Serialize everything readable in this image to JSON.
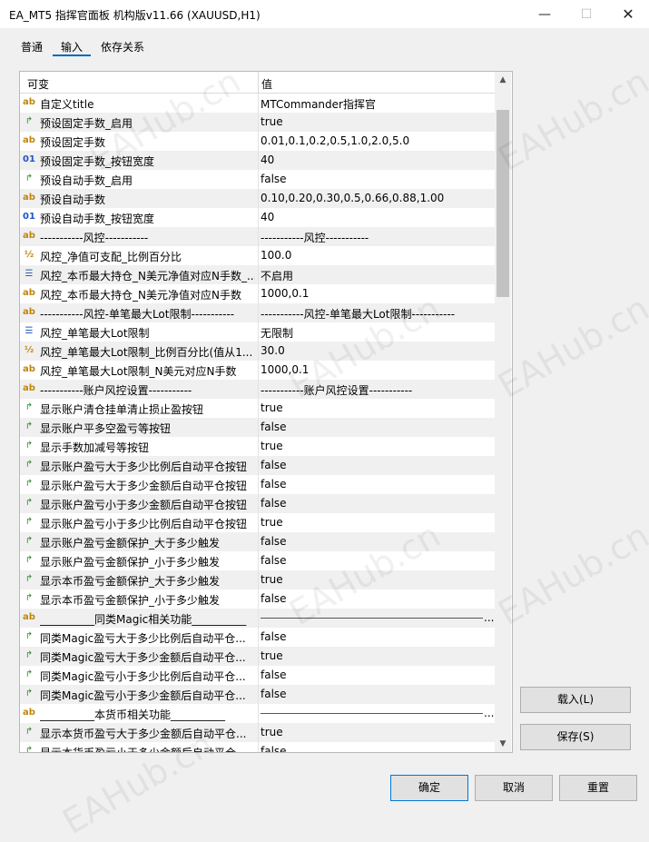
{
  "window": {
    "title": "EA_MT5 指挥官面板 机构版v11.66 (XAUUSD,H1)",
    "min_glyph": "—",
    "max_glyph": "☐",
    "close_glyph": "✕"
  },
  "tabs": [
    {
      "label": "普通"
    },
    {
      "label": "输入"
    },
    {
      "label": "依存关系"
    }
  ],
  "table": {
    "col_variable": "可变",
    "col_value": "值",
    "rows": [
      {
        "type": "ab",
        "name": "自定义title",
        "value": "MTCommander指挥官"
      },
      {
        "type": "bool",
        "name": "预设固定手数_启用",
        "value": "true"
      },
      {
        "type": "ab",
        "name": "预设固定手数",
        "value": "0.01,0.1,0.2,0.5,1.0,2.0,5.0"
      },
      {
        "type": "int",
        "name": "预设固定手数_按钮宽度",
        "value": "40"
      },
      {
        "type": "bool",
        "name": "预设自动手数_启用",
        "value": "false"
      },
      {
        "type": "ab",
        "name": "预设自动手数",
        "value": "0.10,0.20,0.30,0.5,0.66,0.88,1.00"
      },
      {
        "type": "int",
        "name": "预设自动手数_按钮宽度",
        "value": "40"
      },
      {
        "type": "ab",
        "name": "-----------风控-----------",
        "value": "-----------风控-----------"
      },
      {
        "type": "dbl",
        "name": "风控_净值可支配_比例百分比",
        "value": "100.0"
      },
      {
        "type": "enum",
        "name": "风控_本币最大持仓_N美元净值对应N手数_...",
        "value": "不启用"
      },
      {
        "type": "ab",
        "name": "风控_本币最大持仓_N美元净值对应N手数",
        "value": "1000,0.1"
      },
      {
        "type": "ab",
        "name": "-----------风控-单笔最大Lot限制-----------",
        "value": "-----------风控-单笔最大Lot限制-----------"
      },
      {
        "type": "enum",
        "name": "风控_单笔最大Lot限制",
        "value": "无限制"
      },
      {
        "type": "dbl",
        "name": "风控_单笔最大Lot限制_比例百分比(值从1...",
        "value": "30.0"
      },
      {
        "type": "ab",
        "name": "风控_单笔最大Lot限制_N美元对应N手数",
        "value": "1000,0.1"
      },
      {
        "type": "ab",
        "name": "-----------账户风控设置-----------",
        "value": "-----------账户风控设置-----------"
      },
      {
        "type": "bool",
        "name": "显示账户清仓挂单清止损止盈按钮",
        "value": "true"
      },
      {
        "type": "bool",
        "name": "显示账户平多空盈亏等按钮",
        "value": "false"
      },
      {
        "type": "bool",
        "name": "显示手数加减号等按钮",
        "value": "true"
      },
      {
        "type": "bool",
        "name": "显示账户盈亏大于多少比例后自动平仓按钮",
        "value": "false"
      },
      {
        "type": "bool",
        "name": "显示账户盈亏大于多少金额后自动平仓按钮",
        "value": "false"
      },
      {
        "type": "bool",
        "name": "显示账户盈亏小于多少金额后自动平仓按钮",
        "value": "false"
      },
      {
        "type": "bool",
        "name": "显示账户盈亏小于多少比例后自动平仓按钮",
        "value": "true"
      },
      {
        "type": "bool",
        "name": "显示账户盈亏金额保护_大于多少触发",
        "value": "false"
      },
      {
        "type": "bool",
        "name": "显示账户盈亏金额保护_小于多少触发",
        "value": "false"
      },
      {
        "type": "bool",
        "name": "显示本币盈亏金额保护_大于多少触发",
        "value": "true"
      },
      {
        "type": "bool",
        "name": "显示本币盈亏金额保护_小于多少触发",
        "value": "false"
      },
      {
        "type": "ab",
        "name": "__________同类Magic相关功能__________",
        "value": "",
        "line": true
      },
      {
        "type": "bool",
        "name": "同类Magic盈亏大于多少比例后自动平仓...",
        "value": "false"
      },
      {
        "type": "bool",
        "name": "同类Magic盈亏大于多少金额后自动平仓...",
        "value": "true"
      },
      {
        "type": "bool",
        "name": "同类Magic盈亏小于多少比例后自动平仓...",
        "value": "false"
      },
      {
        "type": "bool",
        "name": "同类Magic盈亏小于多少金额后自动平仓...",
        "value": "false"
      },
      {
        "type": "ab",
        "name": "__________本货币相关功能__________",
        "value": "",
        "line": true
      },
      {
        "type": "bool",
        "name": "显示本货币盈亏大于多少金额后自动平仓...",
        "value": "true"
      },
      {
        "type": "bool",
        "name": "显示本货币盈亏小于多少金额后自动平仓...",
        "value": "false"
      }
    ]
  },
  "icons": {
    "ab": "ab",
    "bool": "↱",
    "int": "01",
    "dbl": "½",
    "enum": "☰"
  },
  "ellipsis": "...",
  "buttons": {
    "load": "载入(L)",
    "save": "保存(S)",
    "ok": "确定",
    "cancel": "取消",
    "reset": "重置"
  },
  "watermark": "EAHub.cn"
}
